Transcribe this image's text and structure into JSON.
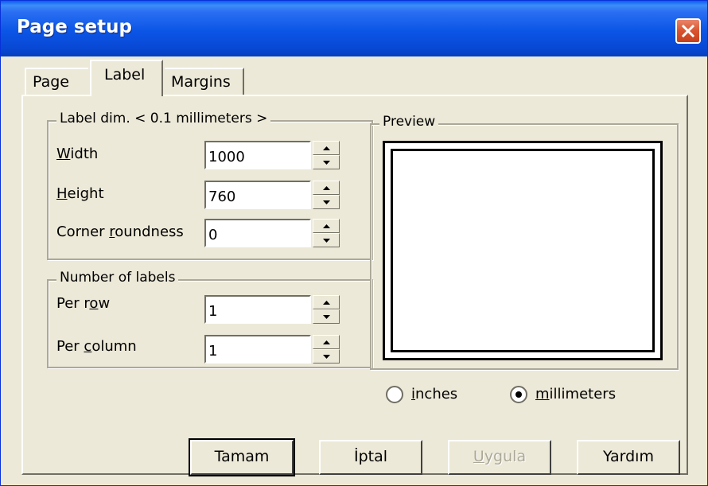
{
  "window": {
    "title": "Page setup",
    "close_icon": "close-icon"
  },
  "tabs": [
    {
      "label": "Page",
      "active": false
    },
    {
      "label": "Label",
      "active": true
    },
    {
      "label": "Margins",
      "active": false
    }
  ],
  "label_dim": {
    "legend": "Label dim. < 0.1 millimeters >",
    "width_label_u": "W",
    "width_label_rest": "idth",
    "width_value": "1000",
    "height_label_u": "H",
    "height_label_rest": "eight",
    "height_value": "760",
    "corner_label_pre": "Corner ",
    "corner_label_u": "r",
    "corner_label_rest": "oundness",
    "corner_value": "0"
  },
  "num_labels": {
    "legend": "Number of labels",
    "row_label_pre": "Per r",
    "row_label_u": "o",
    "row_label_rest": "w",
    "row_value": "1",
    "col_label_pre": "Per ",
    "col_label_u": "c",
    "col_label_rest": "olumn",
    "col_value": "1"
  },
  "preview": {
    "legend": "Preview"
  },
  "units": {
    "inches_u": "i",
    "inches_rest": "nches",
    "mm_u": "m",
    "mm_rest": "illimeters",
    "selected": "millimeters"
  },
  "buttons": {
    "ok": "Tamam",
    "cancel": "İptal",
    "apply_u": "U",
    "apply_rest": "ygula",
    "help": "Yardım"
  }
}
